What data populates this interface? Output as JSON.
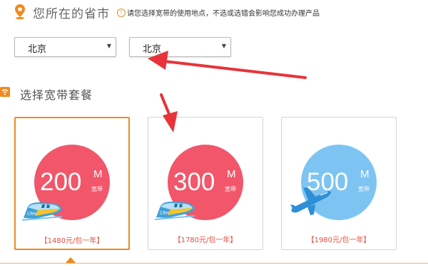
{
  "province_section": {
    "title": "您所在的省市",
    "notice_icon": "info-icon",
    "notice": "请您选择宽带的使用地点，不选或选错会影响您成功办理产品",
    "province_select": {
      "value": "北京"
    },
    "city_select": {
      "value": "北京"
    }
  },
  "plan_section": {
    "title": "选择宽带套餐",
    "plans": [
      {
        "speed": "200",
        "unit": "M",
        "unit_sub": "宽带",
        "price": "【1480元/包一年】",
        "icon": "train-icon",
        "selected": true
      },
      {
        "speed": "300",
        "unit": "M",
        "unit_sub": "宽带",
        "price": "【1780元/包一年】",
        "icon": "train-icon",
        "selected": false
      },
      {
        "speed": "500",
        "unit": "M",
        "unit_sub": "宽带",
        "price": "【1980元/包一年】",
        "icon": "plane-icon",
        "selected": false
      }
    ]
  },
  "colors": {
    "accent": "#f08a1c",
    "circle_red": "#f2566a",
    "circle_blue": "#7dc4f2",
    "price_red": "#e84c3d",
    "annotation_arrow": "#e8333a"
  }
}
